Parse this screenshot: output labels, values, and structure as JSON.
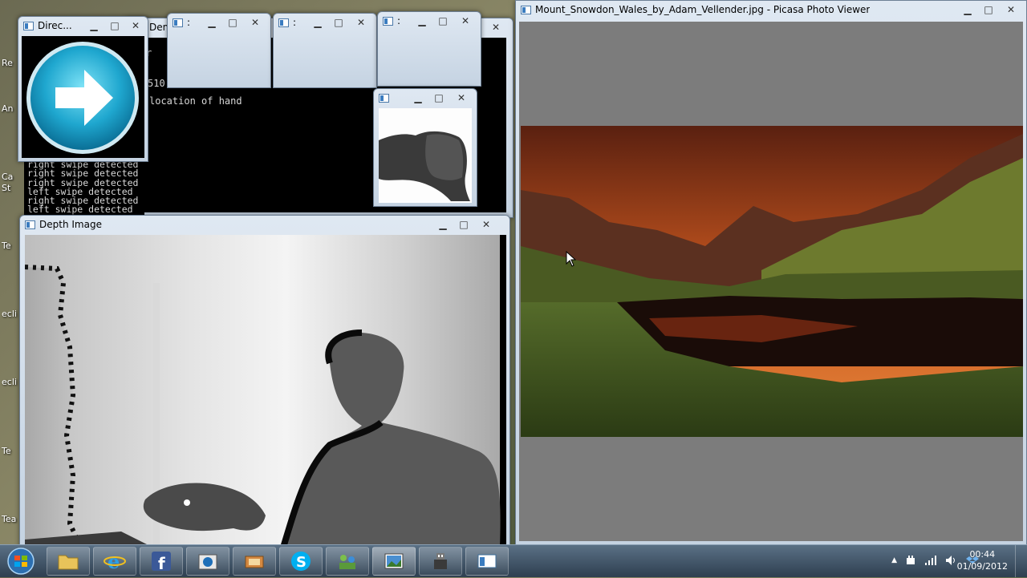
{
  "desktop": {
    "labels": [
      "Re",
      "An",
      "Ca",
      "St",
      "Te",
      "ecli",
      "ecli",
      "Te",
      "Tea"
    ]
  },
  "windows": {
    "direction": {
      "title": "Direc...",
      "icon": "arrow-right-icon"
    },
    "console": {
      "title_fragment": "Demo",
      "frag_r": "r",
      "frag_num": "510",
      "frag_hand": "location of hand",
      "lines": [
        "right swipe detected",
        "right swipe detected",
        "right swipe detected",
        "left swipe detected",
        "right swipe detected",
        "left swipe detected"
      ]
    },
    "thumb1": {
      "title": ":"
    },
    "thumb2": {
      "title": ":"
    },
    "thumb3": {
      "title": ":"
    },
    "thumb4": {
      "title": ""
    },
    "depth": {
      "title": "Depth Image"
    },
    "picasa": {
      "title": "Mount_Snowdon_Wales_by_Adam_Vellender.jpg - Picasa Photo Viewer"
    }
  },
  "window_controls": {
    "minimize": "▁",
    "maximize": "□",
    "close": "✕"
  },
  "taskbar": {
    "items": [
      "folder-icon",
      "ie-icon",
      "facebook-icon",
      "hp-icon",
      "media-icon",
      "skype-icon",
      "network-people-icon",
      "picasa-icon",
      "usb-icon",
      "window-icon"
    ],
    "tray_arrow": "▲",
    "clock_time": "00:44",
    "clock_date": "01/09/2012"
  }
}
